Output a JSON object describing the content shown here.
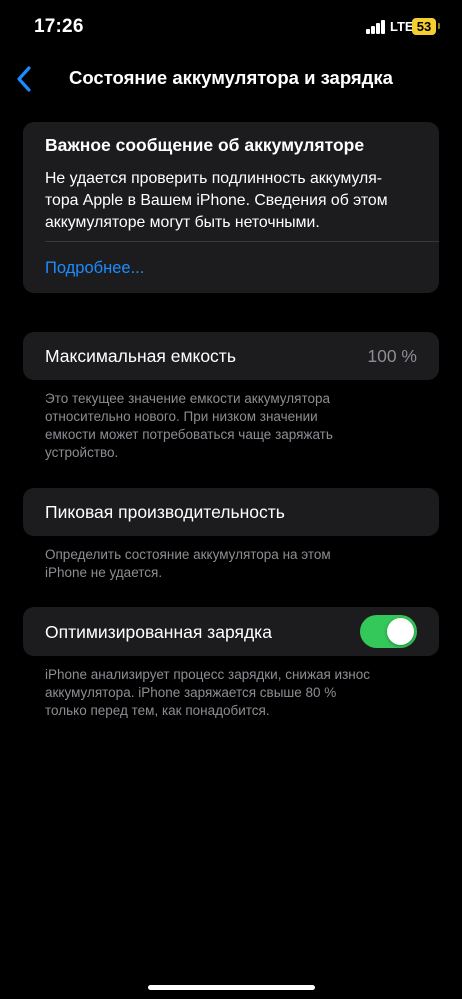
{
  "status_bar": {
    "time": "17:26",
    "network": "LTE",
    "battery_level": "53",
    "battery_color": "#f5cf30"
  },
  "nav": {
    "back_icon": "chevron-left-icon",
    "title": "Состояние аккумулятора и зарядка",
    "accent_color": "#1a8cff"
  },
  "alert": {
    "title": "Важное сообщение об аккумуляторе",
    "line1": "Не удается проверить подлинность аккумуля-",
    "line2": "тора Apple в Вашем iPhone. Сведения об этом",
    "line3": "аккумуляторе могут быть неточными.",
    "link": "Подробнее..."
  },
  "max_capacity": {
    "label": "Максимальная емкость",
    "value": "100 %",
    "footnote_line1": "Это текущее значение емкости аккумулятора",
    "footnote_line2": "относительно нового. При низком значении",
    "footnote_line3": "емкости может потребоваться чаще заряжать",
    "footnote_line4": "устройство."
  },
  "peak_performance": {
    "label": "Пиковая производительность",
    "footnote_line1": "Определить состояние аккумулятора на этом",
    "footnote_line2": "iPhone не удается."
  },
  "optimized_charging": {
    "label": "Оптимизированная зарядка",
    "enabled": true,
    "toggle_color": "#34c759",
    "footnote_line1": "iPhone анализирует процесс зарядки, снижая износ",
    "footnote_line2": "аккумулятора. iPhone заряжается свыше 80 %",
    "footnote_line3": "только перед тем, как понадобится."
  }
}
